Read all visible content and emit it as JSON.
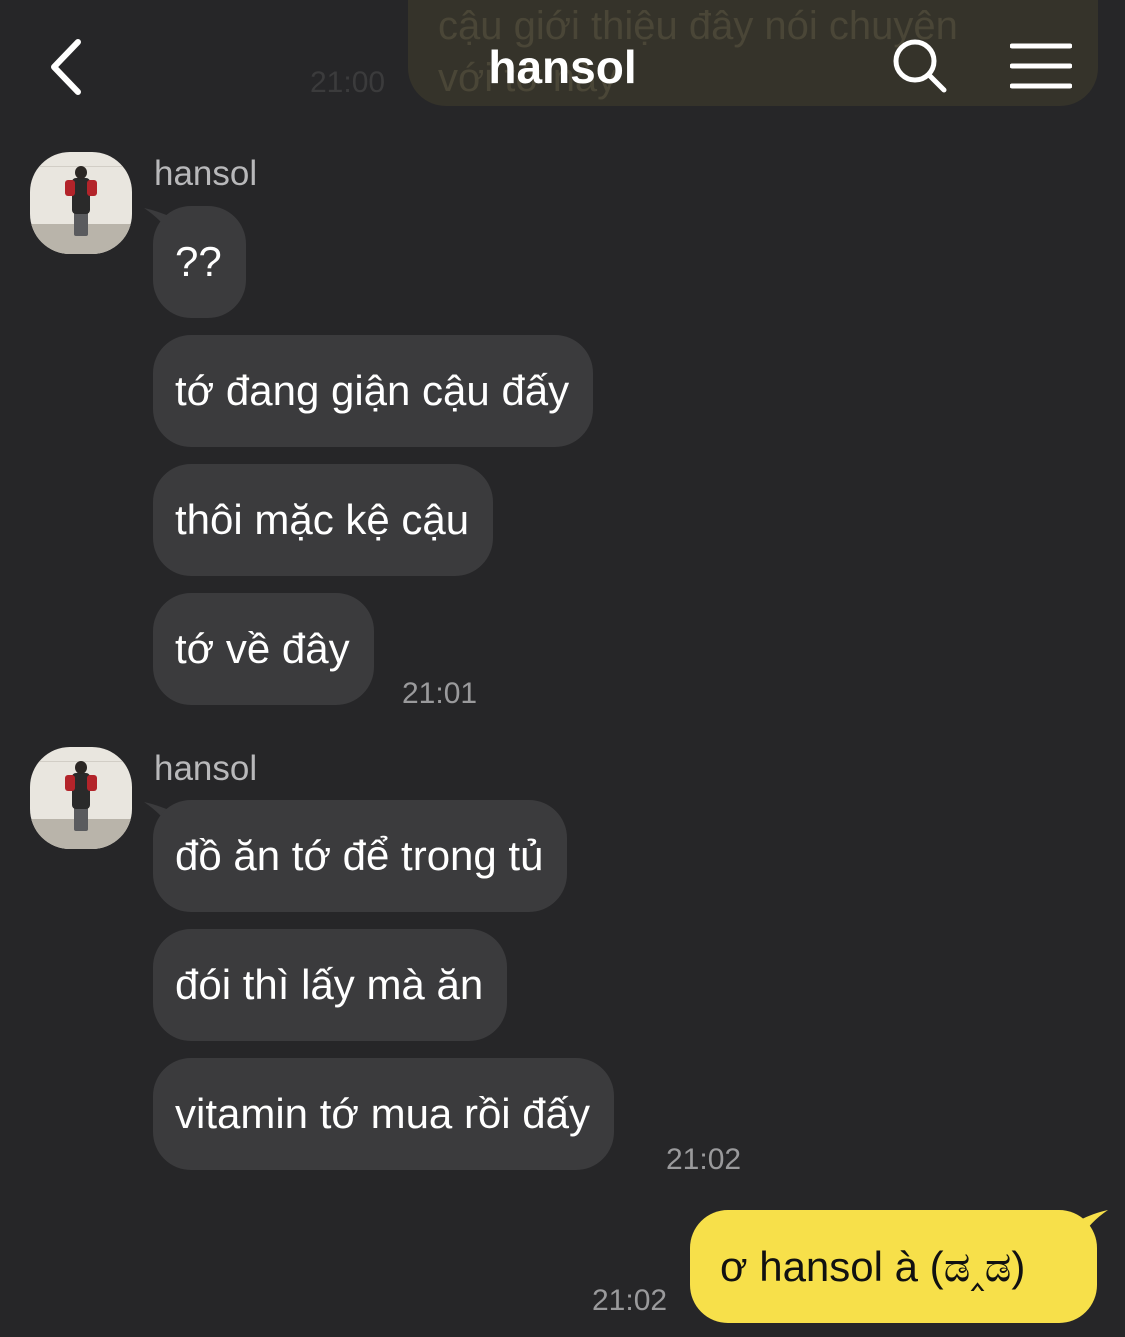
{
  "header": {
    "title": "hansol",
    "back_icon": "chevron-left-icon",
    "search_icon": "search-icon",
    "menu_icon": "hamburger-menu-icon"
  },
  "ghost": {
    "text": "cậu giới thiệu đây nói chuyện\nvới tớ này",
    "time": "21:00"
  },
  "groups": [
    {
      "sender": "hansol",
      "messages": [
        "??",
        "tớ đang giận cậu đấy",
        "thôi mặc kệ cậu",
        "tớ về đây"
      ],
      "time": "21:01"
    },
    {
      "sender": "hansol",
      "messages": [
        "đồ ăn tớ để trong tủ",
        "đói thì lấy mà ăn",
        "vitamin tớ mua rồi đấy"
      ],
      "time": "21:02"
    }
  ],
  "outgoing": {
    "text": "ơ hansol à (ಡ‸ಡ)",
    "time": "21:02"
  },
  "colors": {
    "background": "#262628",
    "incoming_bubble": "#3b3b3d",
    "outgoing_bubble": "#f7e04a"
  }
}
